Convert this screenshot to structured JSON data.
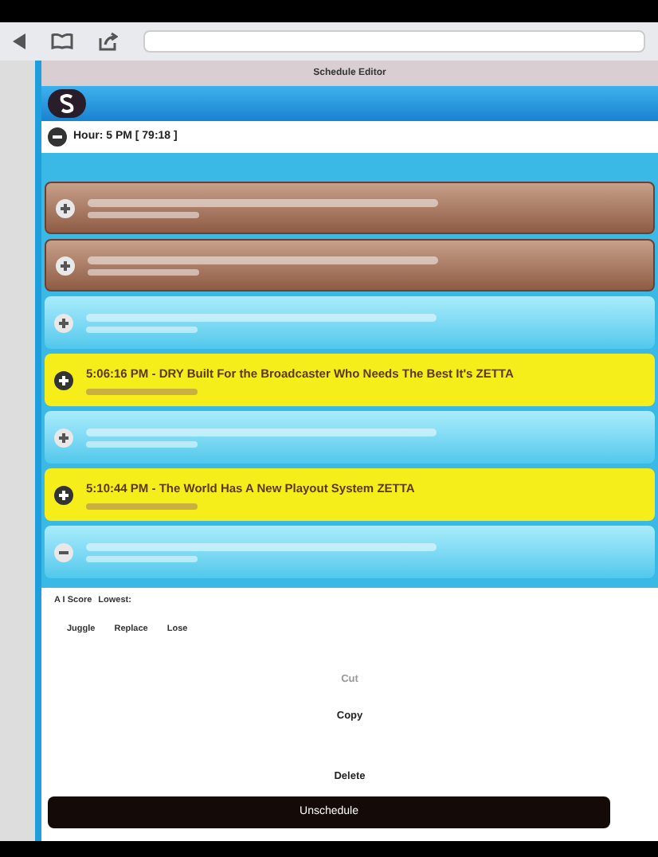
{
  "page": {
    "title": "Schedule Editor"
  },
  "hour": {
    "label": "Hour: 5 PM [ 79:18 ]",
    "expanded": true
  },
  "rows": [
    {
      "kind": "brown",
      "expanded": false
    },
    {
      "kind": "brown",
      "expanded": false
    },
    {
      "kind": "blue",
      "expanded": false
    },
    {
      "kind": "yellow",
      "expanded": false,
      "title": "5:06:16 PM - DRY Built For the Broadcaster Who Needs The Best It's ZETTA"
    },
    {
      "kind": "blue",
      "expanded": false
    },
    {
      "kind": "yellow",
      "expanded": false,
      "title": "5:10:44 PM - The World Has A New Playout System ZETTA"
    },
    {
      "kind": "blue",
      "expanded": true
    }
  ],
  "score": {
    "label": "A I Score",
    "lowest": "Lowest:"
  },
  "actions": [
    "Juggle",
    "Replace",
    "Lose"
  ],
  "menu": [
    {
      "label": "Cut",
      "disabled": true
    },
    {
      "label": "Copy",
      "disabled": false
    },
    {
      "label": "Delete",
      "disabled": false
    }
  ],
  "unschedule": "Unschedule"
}
